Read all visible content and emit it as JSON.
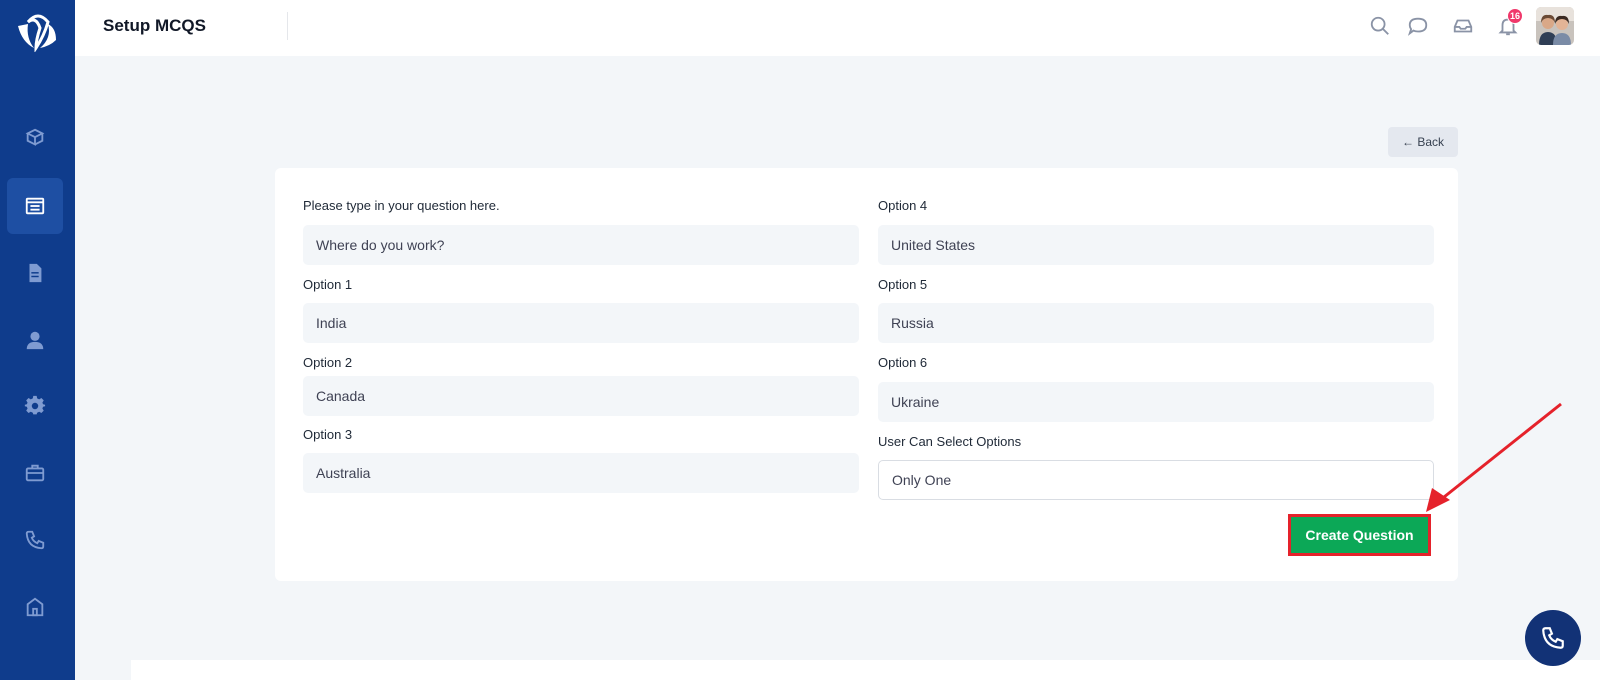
{
  "header": {
    "title": "Setup MCQS",
    "notification_count": "16"
  },
  "sidebar": {
    "items": [
      {
        "icon": "package-icon",
        "active": false
      },
      {
        "icon": "form-list-icon",
        "active": true
      },
      {
        "icon": "document-icon",
        "active": false
      },
      {
        "icon": "user-icon",
        "active": false
      },
      {
        "icon": "gear-icon",
        "active": false
      },
      {
        "icon": "briefcase-icon",
        "active": false
      },
      {
        "icon": "phone-icon",
        "active": false
      },
      {
        "icon": "building-icon",
        "active": false
      }
    ]
  },
  "actions": {
    "back_label": "← Back",
    "create_label": "Create Question"
  },
  "form": {
    "question": {
      "label": "Please type in your question here.",
      "value": "Where do you work?"
    },
    "option1": {
      "label": "Option 1",
      "value": "India"
    },
    "option2": {
      "label": "Option 2",
      "value": "Canada"
    },
    "option3": {
      "label": "Option 3",
      "value": "Australia"
    },
    "option4": {
      "label": "Option 4",
      "value": "United States"
    },
    "option5": {
      "label": "Option 5",
      "value": "Russia"
    },
    "option6": {
      "label": "Option 6",
      "value": "Ukraine"
    },
    "select_mode": {
      "label": "User Can Select Options",
      "value": "Only One"
    }
  },
  "colors": {
    "sidebar": "#0f3c8c",
    "primary_button": "#0ca857",
    "highlight": "#e5222b",
    "badge": "#f0386b"
  }
}
